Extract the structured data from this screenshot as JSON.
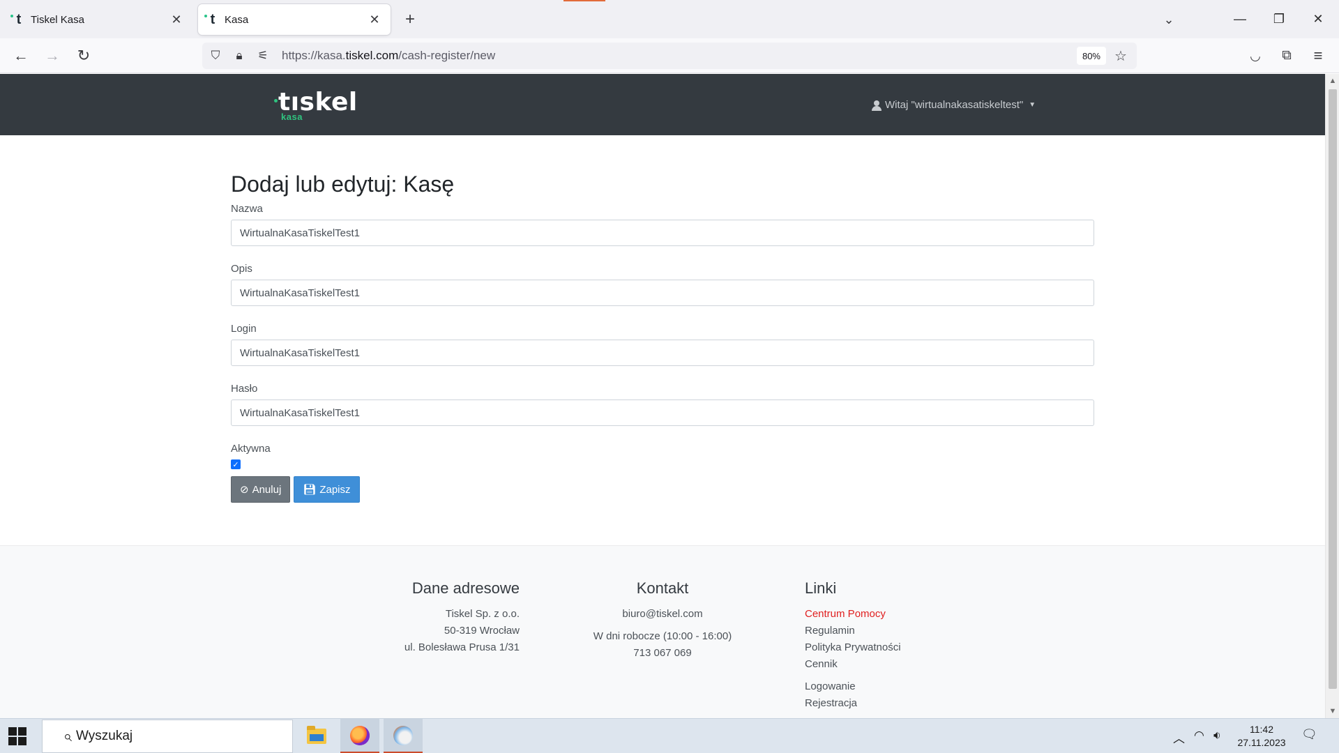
{
  "browser": {
    "tabs": [
      {
        "label": "Tiskel Kasa",
        "favicon": "tiskel-favicon",
        "active": false
      },
      {
        "label": "Kasa",
        "favicon": "tiskel-favicon",
        "active": true
      }
    ],
    "url_prefix": "https://kasa.",
    "url_domain": "tiskel.com",
    "url_path": "/cash-register/new",
    "zoom": "80%"
  },
  "header": {
    "logo_word": "tıskel",
    "logo_sub": "kasa",
    "user_greeting": "Witaj \"wirtualnakasatiskeltest\""
  },
  "form": {
    "title": "Dodaj lub edytuj: Kasę",
    "fields": [
      {
        "label": "Nazwa",
        "value": "WirtualnaKasaTiskelTest1"
      },
      {
        "label": "Opis",
        "value": "WirtualnaKasaTiskelTest1"
      },
      {
        "label": "Login",
        "value": "WirtualnaKasaTiskelTest1"
      },
      {
        "label": "Hasło",
        "value": "WirtualnaKasaTiskelTest1"
      }
    ],
    "active_label": "Aktywna",
    "active_checked": true,
    "cancel_label": "Anuluj",
    "save_label": "Zapisz"
  },
  "footer": {
    "address": {
      "heading": "Dane adresowe",
      "lines": [
        "Tiskel Sp. z o.o.",
        "50-319 Wrocław",
        "ul. Bolesława Prusa 1/31"
      ]
    },
    "contact": {
      "heading": "Kontakt",
      "email": "biuro@tiskel.com",
      "hours": "W dni robocze (10:00 - 16:00)",
      "phone": "713 067 069"
    },
    "links": {
      "heading": "Linki",
      "items": [
        "Centrum Pomocy",
        "Regulamin",
        "Polityka Prywatności",
        "Cennik",
        "Logowanie",
        "Rejestracja"
      ]
    }
  },
  "taskbar": {
    "search_placeholder": "Wyszukaj",
    "time": "11:42",
    "date": "27.11.2023"
  },
  "colors": {
    "header_bg": "#343a40",
    "brand_green": "#2fc37f",
    "save_button": "#3f8fd8",
    "cancel_button": "#6c757d",
    "link_red": "#e02020"
  }
}
